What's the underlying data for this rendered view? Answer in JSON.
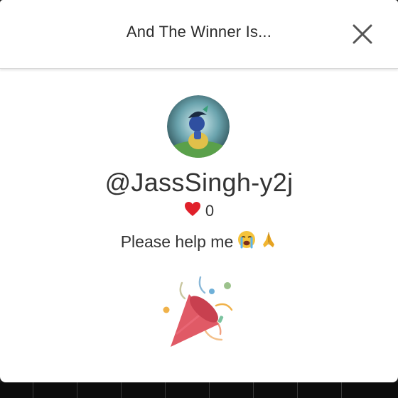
{
  "modal": {
    "title": "And The Winner Is...",
    "close_icon": "close-icon"
  },
  "winner": {
    "avatar_icon": "avatar-image",
    "username": "@JassSingh-y2j",
    "likes_icon": "heart-icon",
    "likes_count": "0",
    "comment_text": "Please help me",
    "comment_emojis": [
      "crying-face-emoji",
      "folded-hands-emoji"
    ],
    "celebration_icon": "party-popper-icon"
  },
  "colors": {
    "heart": "#e0202a",
    "background": "#ffffff",
    "text": "#333333"
  }
}
